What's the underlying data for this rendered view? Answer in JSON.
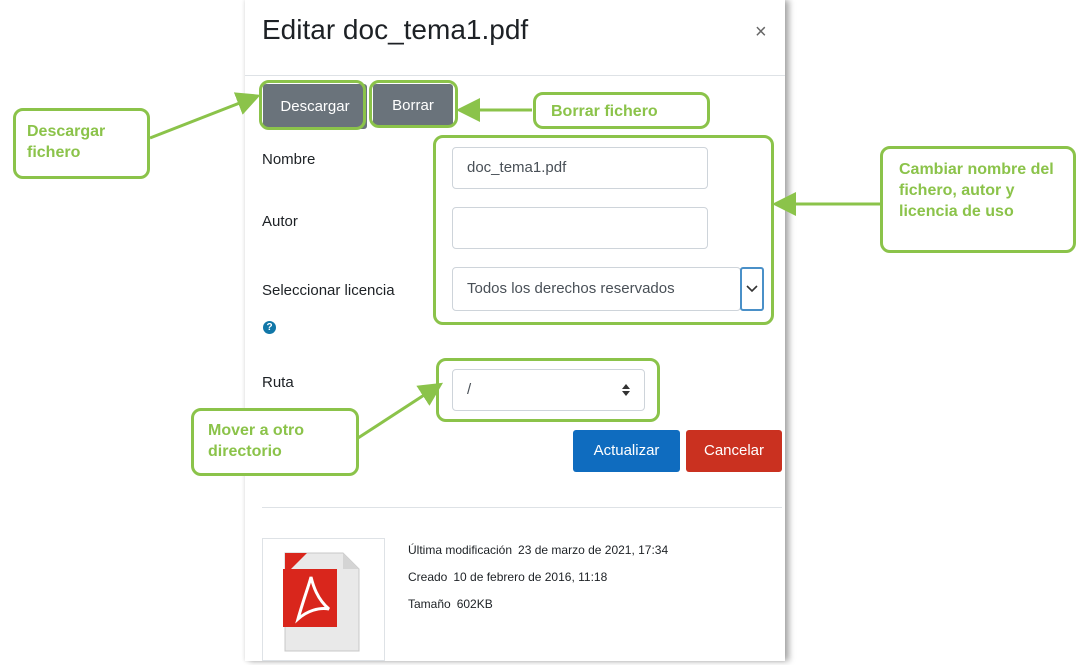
{
  "dialog": {
    "title": "Editar doc_tema1.pdf",
    "close_glyph": "×"
  },
  "actions": {
    "download_label": "Descargar",
    "delete_label": "Borrar"
  },
  "form": {
    "name_label": "Nombre",
    "name_value": "doc_tema1.pdf",
    "author_label": "Autor",
    "author_value": "",
    "license_label": "Seleccionar licencia",
    "license_value": "Todos los derechos reservados",
    "path_label": "Ruta",
    "path_value": "/"
  },
  "buttons": {
    "update_label": "Actualizar",
    "cancel_label": "Cancelar"
  },
  "file_info": {
    "modified_label": "Última modificación",
    "modified_value": "23 de marzo de 2021, 17:34",
    "created_label": "Creado",
    "created_value": "10 de febrero de 2016, 11:18",
    "size_label": "Tamaño",
    "size_value": "602KB"
  },
  "annotations": {
    "download": "Descargar fichero",
    "delete": "Borrar fichero",
    "change": "Cambiar nombre del fichero, autor y licencia de uso",
    "move": "Mover a otro directorio"
  },
  "colors": {
    "annotation_green": "#8bc34a",
    "primary_blue": "#0f6cbf",
    "danger_red": "#ca3120",
    "secondary_gray": "#6a737b"
  },
  "icons": {
    "help": "help-icon",
    "file": "pdf-file-icon",
    "close": "close-icon",
    "select": "chevron-down-icon"
  }
}
